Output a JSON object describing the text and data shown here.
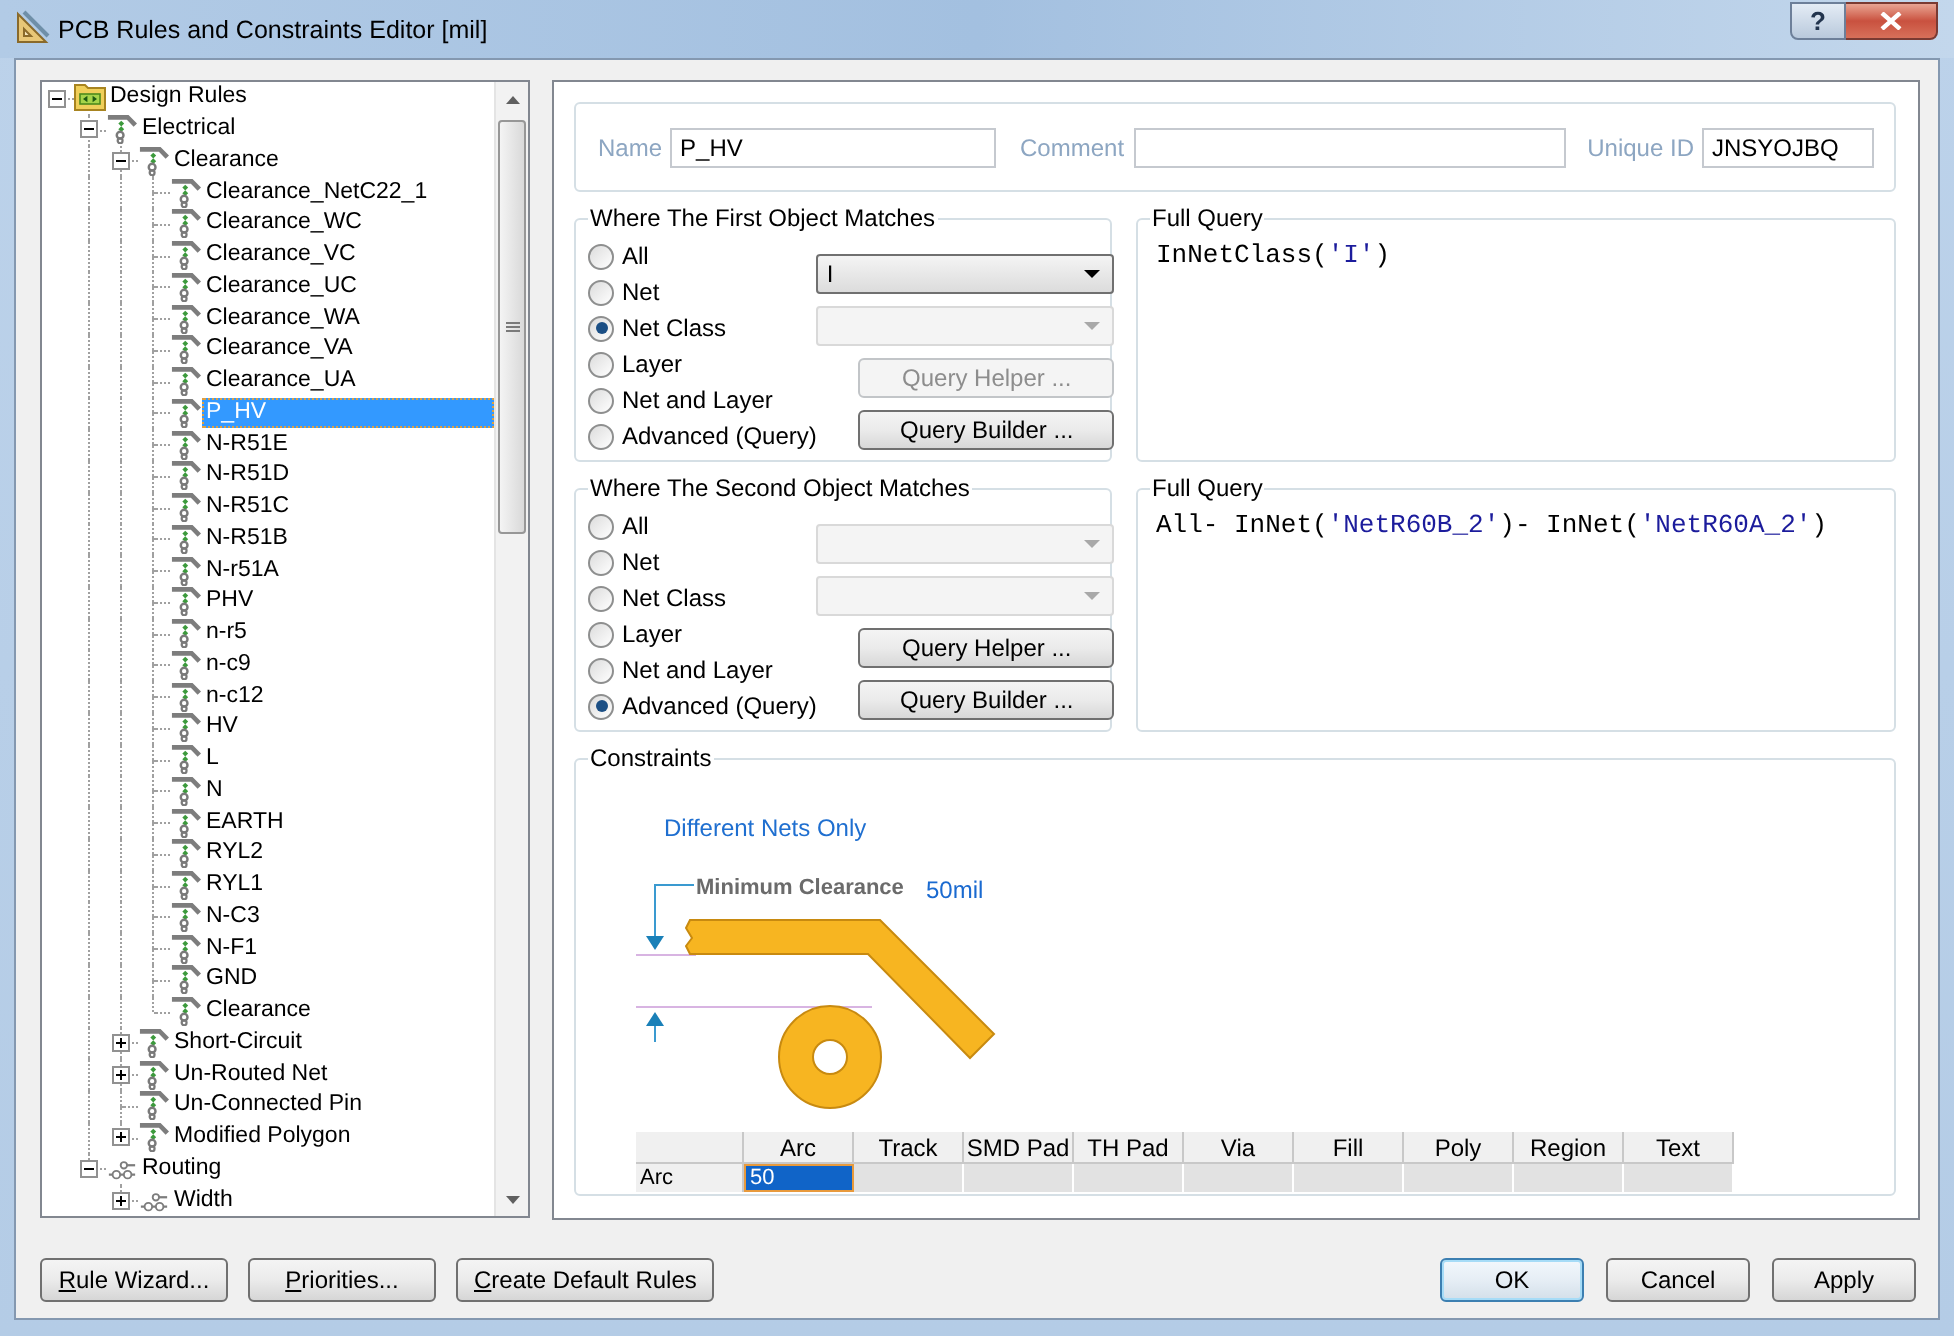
{
  "window": {
    "title": "PCB Rules and Constraints Editor [mil]",
    "help_glyph": "?"
  },
  "rule_tree": {
    "items": [
      {
        "label": "Design Rules",
        "kind": "folder",
        "expanded": true,
        "selected": false,
        "children": [
          {
            "label": "Electrical",
            "kind": "electrical",
            "expanded": true,
            "selected": false,
            "children": [
              {
                "label": "Clearance",
                "kind": "electrical",
                "expanded": true,
                "selected": false,
                "children": [
                  {
                    "label": "Clearance_NetC22_1",
                    "kind": "electrical",
                    "selected": false
                  },
                  {
                    "label": "Clearance_WC",
                    "kind": "electrical",
                    "selected": false
                  },
                  {
                    "label": "Clearance_VC",
                    "kind": "electrical",
                    "selected": false
                  },
                  {
                    "label": "Clearance_UC",
                    "kind": "electrical",
                    "selected": false
                  },
                  {
                    "label": "Clearance_WA",
                    "kind": "electrical",
                    "selected": false
                  },
                  {
                    "label": "Clearance_VA",
                    "kind": "electrical",
                    "selected": false
                  },
                  {
                    "label": "Clearance_UA",
                    "kind": "electrical",
                    "selected": false
                  },
                  {
                    "label": "P_HV",
                    "kind": "electrical",
                    "selected": true
                  },
                  {
                    "label": "N-R51E",
                    "kind": "electrical",
                    "selected": false
                  },
                  {
                    "label": "N-R51D",
                    "kind": "electrical",
                    "selected": false
                  },
                  {
                    "label": "N-R51C",
                    "kind": "electrical",
                    "selected": false
                  },
                  {
                    "label": "N-R51B",
                    "kind": "electrical",
                    "selected": false
                  },
                  {
                    "label": "N-r51A",
                    "kind": "electrical",
                    "selected": false
                  },
                  {
                    "label": "PHV",
                    "kind": "electrical",
                    "selected": false
                  },
                  {
                    "label": "n-r5",
                    "kind": "electrical",
                    "selected": false
                  },
                  {
                    "label": "n-c9",
                    "kind": "electrical",
                    "selected": false
                  },
                  {
                    "label": "n-c12",
                    "kind": "electrical",
                    "selected": false
                  },
                  {
                    "label": "HV",
                    "kind": "electrical",
                    "selected": false
                  },
                  {
                    "label": "L",
                    "kind": "electrical",
                    "selected": false
                  },
                  {
                    "label": "N",
                    "kind": "electrical",
                    "selected": false
                  },
                  {
                    "label": "EARTH",
                    "kind": "electrical",
                    "selected": false
                  },
                  {
                    "label": "RYL2",
                    "kind": "electrical",
                    "selected": false
                  },
                  {
                    "label": "RYL1",
                    "kind": "electrical",
                    "selected": false
                  },
                  {
                    "label": "N-C3",
                    "kind": "electrical",
                    "selected": false
                  },
                  {
                    "label": "N-F1",
                    "kind": "electrical",
                    "selected": false
                  },
                  {
                    "label": "GND",
                    "kind": "electrical",
                    "selected": false
                  },
                  {
                    "label": "Clearance",
                    "kind": "electrical",
                    "selected": false
                  }
                ]
              },
              {
                "label": "Short-Circuit",
                "kind": "electrical",
                "expanded": false,
                "selected": false
              },
              {
                "label": "Un-Routed Net",
                "kind": "electrical",
                "expanded": false,
                "selected": false
              },
              {
                "label": "Un-Connected Pin",
                "kind": "electrical",
                "selected": false
              },
              {
                "label": "Modified Polygon",
                "kind": "electrical",
                "expanded": false,
                "selected": false
              }
            ]
          },
          {
            "label": "Routing",
            "kind": "routing",
            "expanded": true,
            "selected": false,
            "children": [
              {
                "label": "Width",
                "kind": "routing",
                "expanded": false,
                "selected": false
              }
            ]
          }
        ]
      }
    ]
  },
  "rule": {
    "name_label": "Name",
    "name": "P_HV",
    "comment_label": "Comment",
    "unique_id_label": "Unique ID",
    "unique_id": "JNSYOJBQ"
  },
  "first_object": {
    "title": "Where The First Object Matches",
    "options": [
      {
        "label": "All",
        "selected": false
      },
      {
        "label": "Net",
        "selected": false
      },
      {
        "label": "Net Class",
        "selected": true
      },
      {
        "label": "Layer",
        "selected": false
      },
      {
        "label": "Net and Layer",
        "selected": false
      },
      {
        "label": "Advanced (Query)",
        "selected": false
      }
    ],
    "dropdowns": [
      {
        "value": "I",
        "disabled": false
      },
      {
        "disabled": true
      }
    ],
    "buttons": [
      {
        "label": "Query Helper ...",
        "disabled": true
      },
      {
        "label": "Query Builder ...",
        "disabled": false
      }
    ]
  },
  "first_query": {
    "title": "Full Query",
    "tokens": [
      {
        "text": "InNetClass(",
        "kind": "code"
      },
      {
        "text": "'I'",
        "kind": "string"
      },
      {
        "text": ")",
        "kind": "code"
      }
    ]
  },
  "second_object": {
    "title": "Where The Second Object Matches",
    "options": [
      {
        "label": "All",
        "selected": false
      },
      {
        "label": "Net",
        "selected": false
      },
      {
        "label": "Net Class",
        "selected": false
      },
      {
        "label": "Layer",
        "selected": false
      },
      {
        "label": "Net and Layer",
        "selected": false
      },
      {
        "label": "Advanced (Query)",
        "selected": true
      }
    ],
    "dropdowns": [
      {
        "disabled": true
      },
      {
        "disabled": true
      }
    ],
    "buttons": [
      {
        "label": "Query Helper ...",
        "disabled": false
      },
      {
        "label": "Query Builder ...",
        "disabled": false
      }
    ]
  },
  "second_query": {
    "title": "Full Query",
    "tokens": [
      {
        "text": "All- InNet(",
        "kind": "code"
      },
      {
        "text": "'NetR60B_2'",
        "kind": "string"
      },
      {
        "text": ")- InNet(",
        "kind": "code"
      },
      {
        "text": "'NetR60A_2'",
        "kind": "string"
      },
      {
        "text": ")",
        "kind": "code"
      }
    ]
  },
  "constraints": {
    "title": "Constraints",
    "net_scope": "Different Nets Only",
    "clearance_label": "Minimum Clearance",
    "clearance_value": "50mil",
    "table": {
      "columns": [
        "Arc",
        "Track",
        "SMD Pad",
        "TH Pad",
        "Via",
        "Fill",
        "Poly",
        "Region",
        "Text"
      ],
      "rows": [
        {
          "label": "Arc",
          "cells": [
            {
              "value": "50",
              "selected": true
            },
            {
              "selected": false
            },
            {
              "selected": false
            },
            {
              "selected": false
            },
            {
              "selected": false
            },
            {
              "selected": false
            },
            {
              "selected": false
            },
            {
              "selected": false
            },
            {
              "selected": false
            }
          ]
        }
      ]
    }
  },
  "footer": {
    "left_buttons": [
      {
        "label": "Rule Wizard...",
        "accelerator": true,
        "default": false
      },
      {
        "label": "Priorities...",
        "accelerator": true,
        "default": false
      },
      {
        "label": "Create Default Rules",
        "accelerator": true,
        "default": false
      }
    ],
    "right_buttons": [
      {
        "label": "OK",
        "accelerator": false,
        "default": true
      },
      {
        "label": "Cancel",
        "accelerator": false,
        "default": false
      },
      {
        "label": "Apply",
        "accelerator": false,
        "default": false
      }
    ]
  }
}
